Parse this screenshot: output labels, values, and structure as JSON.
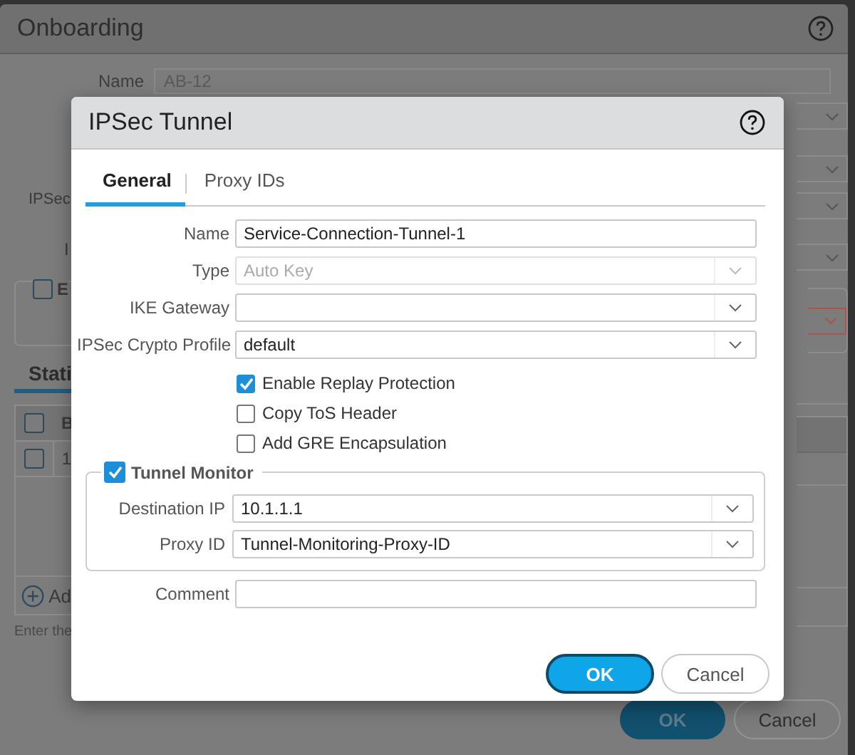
{
  "background_dialog": {
    "title": "Onboarding",
    "name_field": {
      "label": "Name",
      "value": "AB-12"
    },
    "left_labels": [
      "IPSec",
      "I"
    ],
    "checkbox": {
      "label": "E",
      "checked": false
    },
    "tab": {
      "label": "Stati",
      "selected": true
    },
    "table": {
      "header": {
        "checked": false,
        "column_1": "B"
      },
      "rows": [
        {
          "checked": false,
          "column_1": "1"
        }
      ]
    },
    "add_label": "Ad",
    "hint": "Enter the",
    "buttons": [
      {
        "label": "OK",
        "kind": "primary"
      },
      {
        "label": "Cancel",
        "kind": "secondary"
      }
    ]
  },
  "dialog": {
    "title": "IPSec Tunnel",
    "tabs": [
      {
        "label": "General",
        "selected": true
      },
      {
        "label": "Proxy IDs",
        "selected": false
      }
    ],
    "fields": [
      {
        "label": "Name",
        "kind": "text",
        "value": "Service-Connection-Tunnel-1",
        "disabled": false
      },
      {
        "label": "Type",
        "kind": "select",
        "value": "Auto Key",
        "disabled": true
      },
      {
        "label": "IKE Gateway",
        "kind": "select",
        "disabled": false
      },
      {
        "label": "IPSec Crypto Profile",
        "kind": "select",
        "value": "default",
        "disabled": false
      }
    ],
    "options": [
      {
        "label": "Enable Replay Protection",
        "checked": true
      },
      {
        "label": "Copy ToS Header",
        "checked": false
      },
      {
        "label": "Add GRE Encapsulation",
        "checked": false
      }
    ],
    "tunnel_monitor": {
      "label": "Tunnel Monitor",
      "checked": true,
      "fields": [
        {
          "label": "Destination IP",
          "kind": "select",
          "value": "10.1.1.1"
        },
        {
          "label": "Proxy ID",
          "kind": "select",
          "value": "Tunnel-Monitoring-Proxy-ID"
        }
      ]
    },
    "comment": {
      "label": "Comment",
      "kind": "text"
    },
    "buttons": [
      {
        "label": "OK",
        "kind": "primary"
      },
      {
        "label": "Cancel",
        "kind": "secondary"
      }
    ]
  }
}
